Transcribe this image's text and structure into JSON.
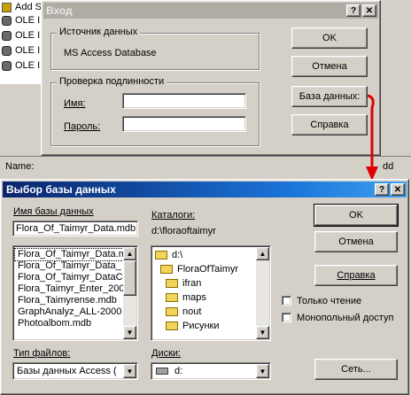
{
  "background_list": {
    "items": [
      "Add S",
      "OLE I",
      "OLE I",
      "OLE I",
      "OLE I"
    ]
  },
  "login_dialog": {
    "title": "Вход",
    "source_group_title": "Источник данных",
    "source_value": "MS Access Database",
    "auth_group_title": "Проверка подлинности",
    "name_label": "Имя:",
    "name_value": "",
    "password_label": "Пароль:",
    "password_value": "",
    "ok_label": "OK",
    "cancel_label": "Отмена",
    "database_label": "База данных:",
    "help_label": "Справка"
  },
  "background_bits": {
    "name_label": "Name:",
    "add_label": "dd"
  },
  "select_db_dialog": {
    "title": "Выбор базы данных",
    "db_name_label": "Имя базы данных",
    "db_name_value": "Flora_Of_Taimyr_Data.mdb",
    "files": [
      "Flora_Of_Taimyr_Data.m",
      "Flora_Of_Taimyr_Data_",
      "Flora_Of_Taimyr_DataC",
      "Flora_Taimyr_Enter_200",
      "Flora_Taimyrense.mdb",
      "GraphAnalyz_ALL-2000",
      "Photoalbom.mdb"
    ],
    "catalogs_label": "Каталоги:",
    "catalogs_path": "d:\\floraoftaimyr",
    "folders": [
      "d:\\",
      "FloraOfTaimyr",
      "ifran",
      "maps",
      "nout",
      "Рисунки"
    ],
    "file_type_label": "Тип файлов:",
    "file_type_value": "Базы данных Access (",
    "drives_label": "Диски:",
    "drive_value": "d:",
    "ok_label": "OK",
    "cancel_label": "Отмена",
    "help_label": "Справка",
    "readonly_label": "Только чтение",
    "exclusive_label": "Монопольный доступ",
    "network_label": "Сеть..."
  },
  "colors": {
    "title_inactive": "#b0aca4",
    "title_active_start": "#0a246a",
    "title_active_end": "#3f9ff0",
    "selection": "#0a246a",
    "arrow": "#e00000"
  }
}
